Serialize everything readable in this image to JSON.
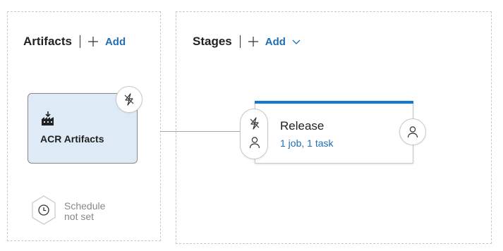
{
  "artifacts": {
    "title": "Artifacts",
    "add_label": "Add",
    "card": {
      "name": "ACR Artifacts",
      "icon": "artifact-build-icon"
    },
    "trigger_icon": "lightning-icon",
    "schedule": {
      "line1": "Schedule",
      "line2": "not set",
      "icon": "clock-icon"
    }
  },
  "stages": {
    "title": "Stages",
    "add_label": "Add",
    "dropdown_icon": "chevron-down-icon",
    "stage": {
      "name": "Release",
      "tasks": "1 job, 1 task",
      "pre_icons": [
        "lightning-icon",
        "person-icon"
      ],
      "post_icon": "person-icon"
    }
  },
  "colors": {
    "accent": "#1f6fb6",
    "stage_bar": "#0f78d4",
    "artifact_bg": "#deebf7",
    "muted": "#8a8886"
  }
}
